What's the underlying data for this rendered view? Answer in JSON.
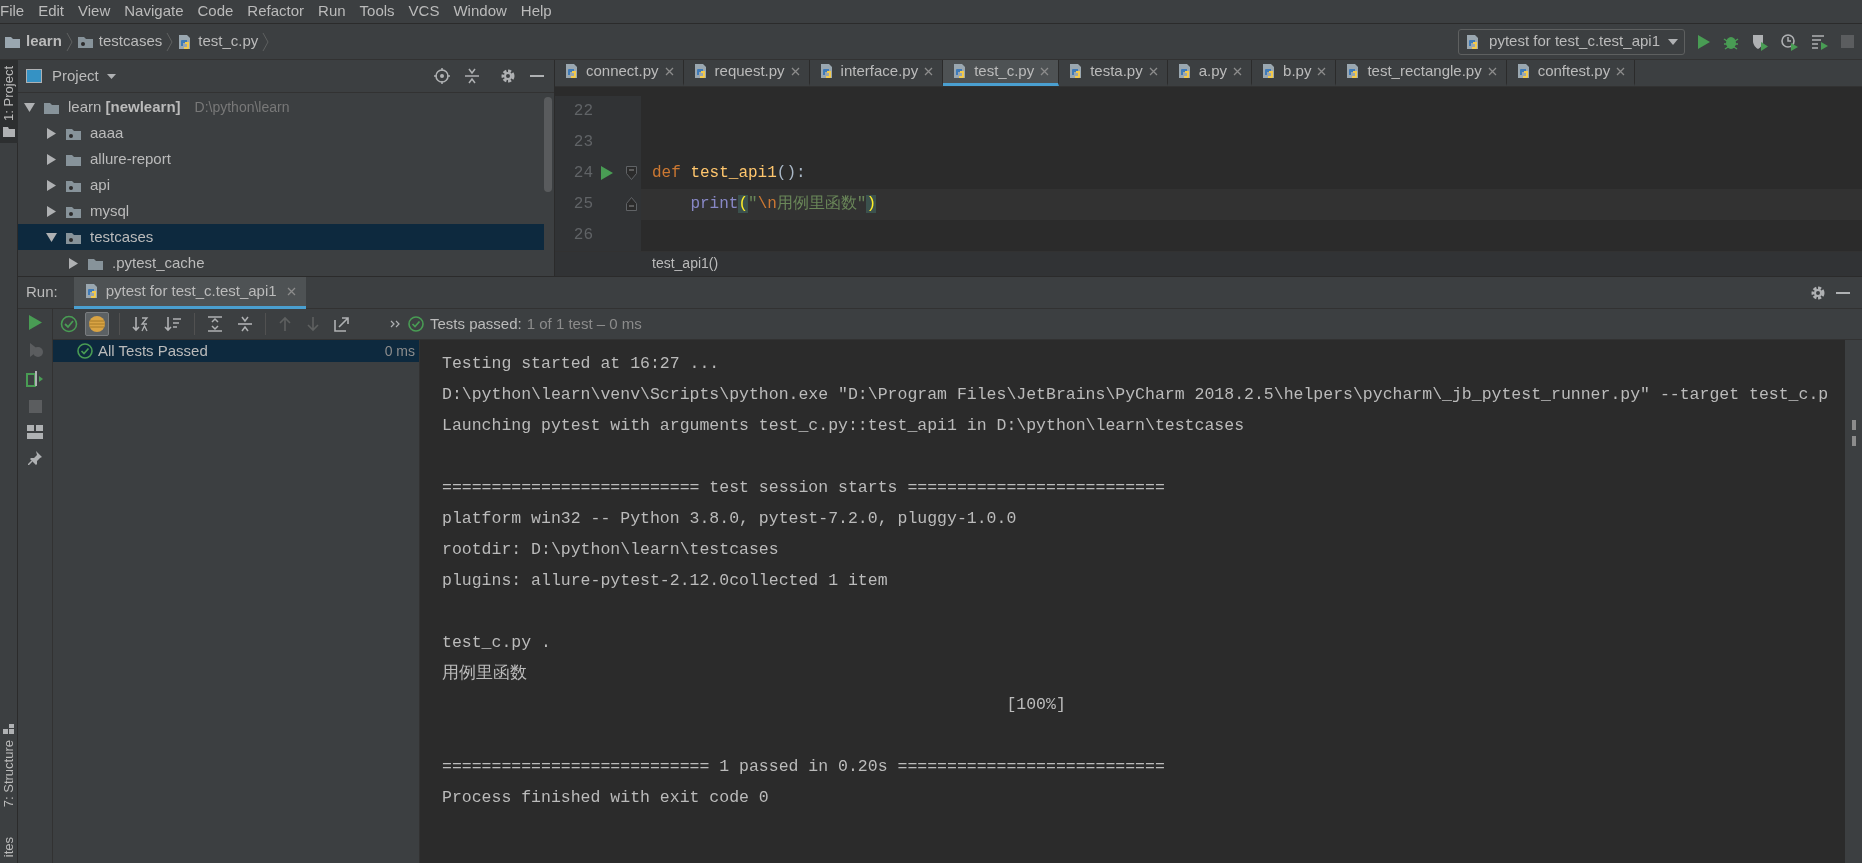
{
  "menu": [
    "File",
    "Edit",
    "View",
    "Navigate",
    "Code",
    "Refactor",
    "Run",
    "Tools",
    "VCS",
    "Window",
    "Help"
  ],
  "breadcrumbs": [
    {
      "label": "learn",
      "kind": "root"
    },
    {
      "label": "testcases",
      "kind": "package"
    },
    {
      "label": "test_c.py",
      "kind": "file"
    }
  ],
  "run_config": {
    "label": "pytest for test_c.test_api1"
  },
  "tool_tabs": [
    {
      "label": "1: Project",
      "selected": true,
      "kind": "top"
    },
    {
      "label": "7: Structure",
      "selected": false,
      "kind": "bottom"
    },
    {
      "label": "ites",
      "selected": false,
      "kind": "bottom"
    }
  ],
  "project_panel": {
    "title": "Project",
    "tree": [
      {
        "label": "learn **[newlearn]**",
        "path": "D:\\python\\learn",
        "kind": "folder",
        "expanded": true,
        "selected": false,
        "children": [
          {
            "label": "aaaa",
            "kind": "package",
            "expanded": false,
            "selected": false
          },
          {
            "label": "allure-report",
            "kind": "folder",
            "expanded": false,
            "selected": false
          },
          {
            "label": "api",
            "kind": "package",
            "expanded": false,
            "selected": false
          },
          {
            "label": "mysql",
            "kind": "package",
            "expanded": false,
            "selected": false
          },
          {
            "label": "testcases",
            "kind": "package",
            "expanded": true,
            "selected": true,
            "children": [
              {
                "label": ".pytest_cache",
                "kind": "folder",
                "expanded": false,
                "selected": false
              }
            ]
          }
        ]
      }
    ]
  },
  "editor_tabs": [
    {
      "label": "connect.py",
      "selected": false
    },
    {
      "label": "request.py",
      "selected": false
    },
    {
      "label": "interface.py",
      "selected": false
    },
    {
      "label": "test_c.py",
      "selected": true
    },
    {
      "label": "testa.py",
      "selected": false
    },
    {
      "label": "a.py",
      "selected": false
    },
    {
      "label": "b.py",
      "selected": false
    },
    {
      "label": "test_rectangle.py",
      "selected": false
    },
    {
      "label": "conftest.py",
      "selected": false
    }
  ],
  "editor": {
    "lines": [
      {
        "number": "22"
      },
      {
        "number": "23"
      },
      {
        "number": "24",
        "run_marker": true,
        "fold_start": true,
        "tokens": [
          {
            "text": "def",
            "kind": "keyword"
          },
          {
            "text": "test_api1",
            "kind": "function"
          },
          {
            "text": "():",
            "kind": "plain"
          }
        ]
      },
      {
        "number": "25",
        "current": true,
        "fold_end": true,
        "indented": true,
        "tokens": [
          {
            "text": "print",
            "kind": "builtin"
          },
          {
            "text": "(",
            "kind": "brace"
          },
          {
            "text": "\"",
            "kind": "string"
          },
          {
            "text": "\\n",
            "kind": "escape"
          },
          {
            "text": "用例里函数\"",
            "kind": "string"
          },
          {
            "text": ")",
            "kind": "brace"
          }
        ]
      },
      {
        "number": "26"
      }
    ],
    "breadcrumb": "test_api1()"
  },
  "run_panel": {
    "label": "Run:",
    "tab": "pytest for test_c.test_api1",
    "toggles": [
      {
        "kind": "show-passed",
        "on": false
      },
      {
        "kind": "show-ignored",
        "on": true
      }
    ],
    "status_label": "Tests passed:",
    "status_detail": "1 of 1 test – 0 ms",
    "tests": [
      {
        "label": "All Tests Passed",
        "time": "0 ms",
        "selected": true
      }
    ],
    "console": [
      {
        "kind": "text",
        "text": "Testing started at 16:27 ..."
      },
      {
        "kind": "text",
        "text": "D:\\python\\learn\\venv\\Scripts\\python.exe \"D:\\Program Files\\JetBrains\\PyCharm 2018.2.5\\helpers\\pycharm\\_jb_pytest_runner.py\" --target test_c.p"
      },
      {
        "kind": "text",
        "text": "Launching pytest with arguments test_c.py::test_api1 in D:\\python\\learn\\testcases"
      },
      {
        "kind": "blank"
      },
      {
        "kind": "text",
        "text": "========================== test session starts =========================="
      },
      {
        "kind": "text",
        "text": "platform win32 -- Python 3.8.0, pytest-7.2.0, pluggy-1.0.0"
      },
      {
        "kind": "text",
        "text": "rootdir: D:\\python\\learn\\testcases"
      },
      {
        "kind": "text",
        "text": "plugins: allure-pytest-2.12.0collected 1 item"
      },
      {
        "kind": "blank"
      },
      {
        "kind": "text",
        "text": "test_c.py ."
      },
      {
        "kind": "text",
        "text": "用例里函数"
      },
      {
        "kind": "progress",
        "text": "[100%]"
      },
      {
        "kind": "blank"
      },
      {
        "kind": "text",
        "text": "=========================== 1 passed in 0.20s ==========================="
      },
      {
        "kind": "text",
        "text": "Process finished with exit code 0"
      }
    ]
  }
}
